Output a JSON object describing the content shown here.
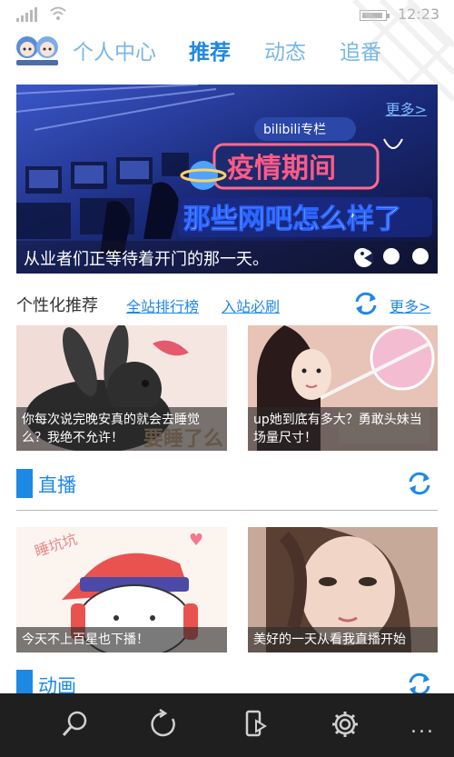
{
  "status_bar": {
    "time": "12:23"
  },
  "nav": {
    "tabs": [
      {
        "label": "个人中心",
        "active": false
      },
      {
        "label": "推荐",
        "active": true
      },
      {
        "label": "动态",
        "active": false
      },
      {
        "label": "追番",
        "active": false
      }
    ]
  },
  "banner": {
    "more_label": "更多>",
    "caption": "从业者们正等待着开门的那一天。",
    "logo_text": "bilibili专栏",
    "headline_top": "疫情期间",
    "headline_bottom": "那些网吧怎么样了",
    "slide_count": 4,
    "active_slide": 3
  },
  "personal": {
    "title": "个性化推荐",
    "link_ranking": "全站排行榜",
    "link_must_watch": "入站必刷",
    "more_label": "更多>"
  },
  "recommend_cards": [
    {
      "caption": "你每次说完晚安真的就会去睡觉么？我绝不允许！"
    },
    {
      "caption": "up她到底有多大？勇敢头妹当场量尺寸！"
    }
  ],
  "live": {
    "title": "直播",
    "cards": [
      {
        "caption": "今天不上百星也下播！",
        "image_text": "睡坑坑"
      },
      {
        "caption": "美好的一天从看我直播开始"
      }
    ]
  },
  "anime": {
    "title": "动画"
  },
  "app_bar": {
    "icons": [
      "search-icon",
      "refresh-icon",
      "cast-icon",
      "settings-icon",
      "more-icon"
    ],
    "more_label": "..."
  },
  "colors": {
    "accent": "#1e88e5",
    "tab_inactive": "#7ab7e6",
    "app_bar": "#1f1f1f"
  }
}
